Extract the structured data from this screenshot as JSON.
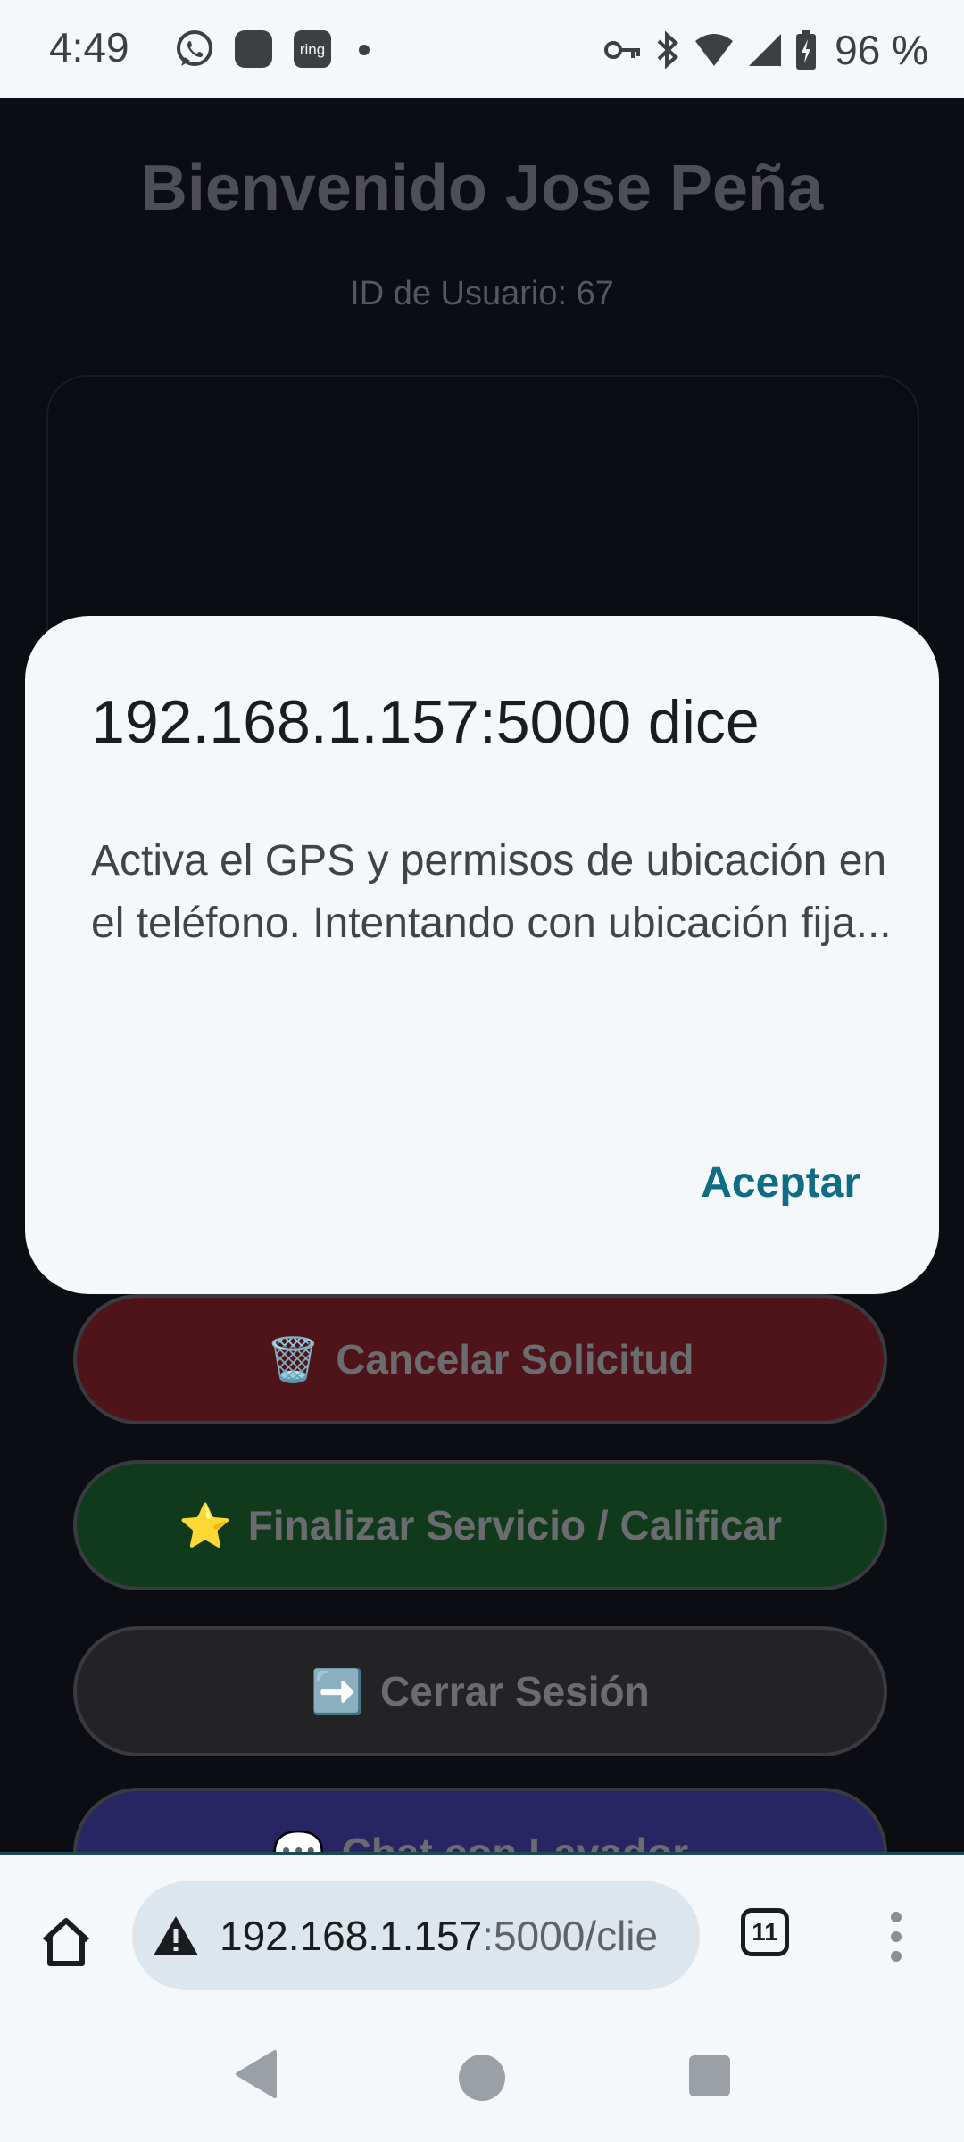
{
  "status_bar": {
    "time": "4:49",
    "left_icons": [
      "whatsapp-icon",
      "app-square-icon",
      "ring-app-icon",
      "dot-icon"
    ],
    "ring_label": "ring",
    "right_icons": [
      "vpn-key-icon",
      "bluetooth-icon",
      "wifi-icon",
      "signal-icon",
      "battery-charging-icon"
    ],
    "battery_percent": "96 %"
  },
  "page": {
    "welcome_title": "Bienvenido Jose Peña",
    "user_id": "ID de Usuario: 67",
    "buttons": {
      "cancel": {
        "emoji": "🗑️",
        "label": "Cancelar Solicitud",
        "color": "#4f141a"
      },
      "finish": {
        "emoji": "⭐",
        "label": "Finalizar Servicio / Calificar",
        "color": "#11391b"
      },
      "logout": {
        "emoji": "➡️",
        "label": "Cerrar Sesión",
        "color": "#232326"
      },
      "chat": {
        "emoji": "💬",
        "label": "Chat con Lavador",
        "color": "#272562"
      }
    }
  },
  "dialog": {
    "title": "192.168.1.157:5000 dice",
    "message": "Activa el GPS y permisos de ubicación en el teléfono. Intentando con ubicación fija...",
    "accept_label": "Aceptar",
    "accent_color": "#0e6c84"
  },
  "browser": {
    "url_host": "192.168.1.157",
    "url_rest": ":5000/clie",
    "tab_count": "11",
    "security_icon": "warning-icon",
    "home_icon": "home-icon",
    "menu_icon": "more-vert-icon"
  },
  "nav": {
    "icons": [
      "back-icon",
      "home-circle-icon",
      "recents-icon"
    ]
  }
}
